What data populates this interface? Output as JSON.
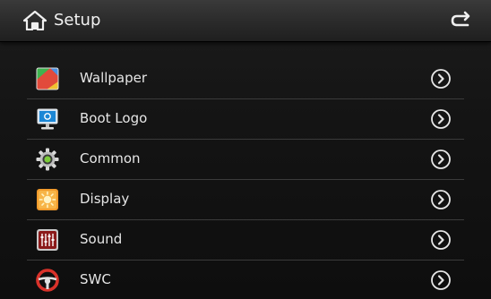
{
  "header": {
    "title": "Setup",
    "home_icon": "home-icon",
    "back_icon": "back-icon"
  },
  "menu": {
    "items": [
      {
        "label": "Wallpaper",
        "icon": "wallpaper-icon"
      },
      {
        "label": "Boot Logo",
        "icon": "monitor-icon"
      },
      {
        "label": "Common",
        "icon": "gear-icon"
      },
      {
        "label": "Display",
        "icon": "brightness-icon"
      },
      {
        "label": "Sound",
        "icon": "equalizer-icon"
      },
      {
        "label": "SWC",
        "icon": "steering-wheel-icon"
      }
    ],
    "chevron_icon": "chevron-right-circle-icon"
  },
  "colors": {
    "background": "#141414",
    "text": "#e6e6e6",
    "divider": "#3b3b3b"
  }
}
